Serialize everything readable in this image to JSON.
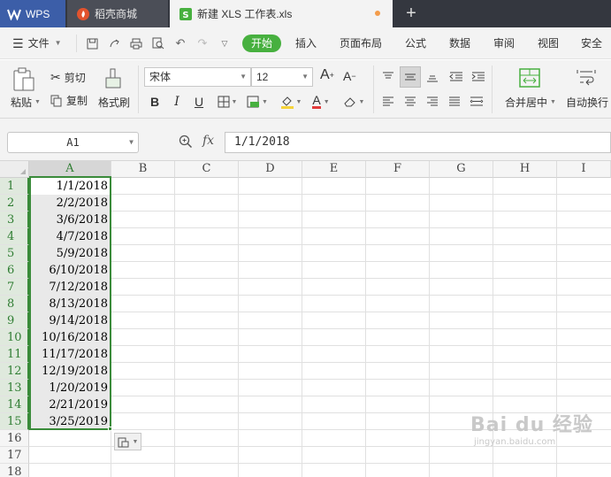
{
  "tabs": {
    "wps": "WPS",
    "store": "稻壳商城",
    "document": "新建 XLS 工作表.xls",
    "new_tab": "+"
  },
  "menu": {
    "file": "文件",
    "items": [
      "开始",
      "插入",
      "页面布局",
      "公式",
      "数据",
      "审阅",
      "视图",
      "安全"
    ]
  },
  "ribbon": {
    "paste": "粘贴",
    "cut": "剪切",
    "copy": "复制",
    "format_painter": "格式刷",
    "font_name": "宋体",
    "font_size": "12",
    "merge_center": "合并居中",
    "wrap_text": "自动换行"
  },
  "formula_bar": {
    "name_box": "A1",
    "fx": "fx",
    "content": "1/1/2018"
  },
  "sheet": {
    "columns": [
      "A",
      "B",
      "C",
      "D",
      "E",
      "F",
      "G",
      "H",
      "I"
    ],
    "rows": [
      "1",
      "2",
      "3",
      "4",
      "5",
      "6",
      "7",
      "8",
      "9",
      "10",
      "11",
      "12",
      "13",
      "14",
      "15",
      "16",
      "17",
      "18"
    ],
    "column_a_values": [
      "1/1/2018",
      "2/2/2018",
      "3/6/2018",
      "4/7/2018",
      "5/9/2018",
      "6/10/2018",
      "7/12/2018",
      "8/13/2018",
      "9/14/2018",
      "10/16/2018",
      "11/17/2018",
      "12/19/2018",
      "1/20/2019",
      "2/21/2019",
      "3/25/2019"
    ],
    "selection": "A1:A15"
  },
  "watermark": {
    "main": "Bai du 经验",
    "sub": "jingyan.baidu.com"
  },
  "colors": {
    "accent_green": "#47b03f",
    "selection_green": "#3a8b3a",
    "tab_blue": "#3c5ea8",
    "titlebar": "#34373f"
  }
}
